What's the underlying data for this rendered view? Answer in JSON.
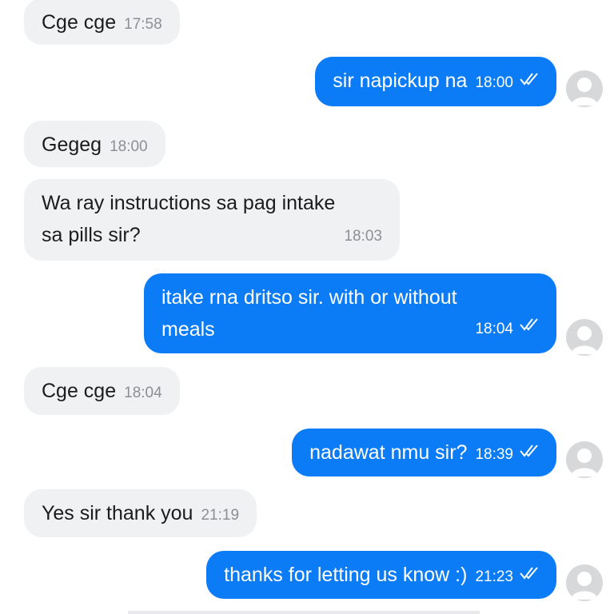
{
  "messages": [
    {
      "text": "Cge cge",
      "time": "17:58",
      "direction": "incoming"
    },
    {
      "text": "sir napickup na",
      "time": "18:00",
      "direction": "outgoing",
      "status_icon": "double-check-icon"
    },
    {
      "text": "Gegeg",
      "time": "18:00",
      "direction": "incoming"
    },
    {
      "line1": "Wa ray instructions sa pag intake",
      "line2": "sa pills sir?",
      "time": "18:03",
      "direction": "incoming"
    },
    {
      "line1": "itake rna dritso sir. with or without",
      "line2": "meals",
      "time": "18:04",
      "direction": "outgoing",
      "status_icon": "double-check-icon"
    },
    {
      "text": "Cge cge",
      "time": "18:04",
      "direction": "incoming"
    },
    {
      "text": "nadawat nmu sir?",
      "time": "18:39",
      "direction": "outgoing",
      "status_icon": "double-check-icon"
    },
    {
      "text": "Yes sir thank you",
      "time": "21:19",
      "direction": "incoming"
    },
    {
      "text": "thanks for letting us know :)",
      "time": "21:23",
      "direction": "outgoing",
      "status_icon": "double-check-icon"
    }
  ],
  "colors": {
    "outgoing_bubble": "#0b7cf6",
    "incoming_bubble": "#f0f1f3",
    "avatar_placeholder": "#d7d8da"
  }
}
